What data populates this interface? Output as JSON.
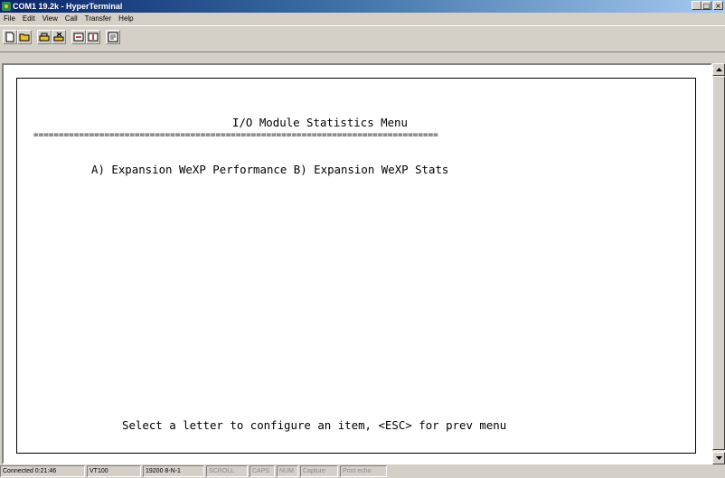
{
  "window": {
    "title": "COM1 19.2k - HyperTerminal",
    "minimize_glyph": "_",
    "maximize_glyph": "□",
    "close_glyph": "×"
  },
  "menu": [
    "File",
    "Edit",
    "View",
    "Call",
    "Transfer",
    "Help"
  ],
  "toolbar": {
    "buttons": [
      "new-icon",
      "open-icon",
      "connect-icon",
      "disconnect-icon",
      "send-icon",
      "receive-icon",
      "properties-icon"
    ]
  },
  "terminal": {
    "heading": "I/O Module Statistics Menu",
    "separator": "================================================================================",
    "options_line": "A) Expansion WeXP Performance B) Expansion WeXP Stats",
    "prompt": "Select a letter to configure an item, <ESC> for prev menu"
  },
  "status": {
    "connected": "Connected 0:21:46",
    "emulation": "VT100",
    "settings": "19200 8-N-1",
    "scroll": "SCROLL",
    "caps": "CAPS",
    "num": "NUM",
    "capture": "Capture",
    "print_echo": "Print echo"
  },
  "colors": {
    "titlebar_start": "#0a246a",
    "titlebar_end": "#a6caf0",
    "chrome": "#d4d0c8",
    "terminal_bg": "#ffffff"
  }
}
